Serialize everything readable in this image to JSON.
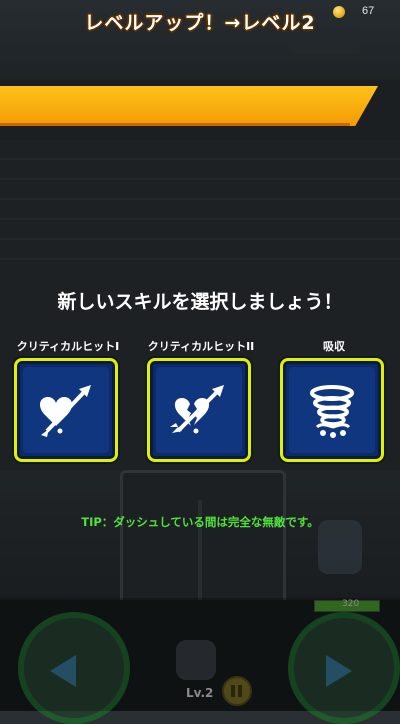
{
  "hud": {
    "coin_icon": "coin-icon",
    "coin_count": "67",
    "hp_text": "320",
    "hp_fraction": 1.0,
    "level_label": "Lv.2"
  },
  "banner": {
    "text": "レベルアップ！→レベル2"
  },
  "prompt": "新しいスキルを選択しましょう！",
  "skills": [
    {
      "label": "クリティカルヒットI",
      "icon": "heart-arrow-icon"
    },
    {
      "label": "クリティカルヒットII",
      "icon": "broken-heart-arrow-icon"
    },
    {
      "label": "吸収",
      "icon": "whirlwind-absorb-icon"
    }
  ],
  "tip": "TIP：ダッシュしている間は完全な無敵です。",
  "colors": {
    "banner": "#f7a90e",
    "card_border": "#dff000",
    "card_bg": "#113680",
    "tip": "#52e23c"
  }
}
